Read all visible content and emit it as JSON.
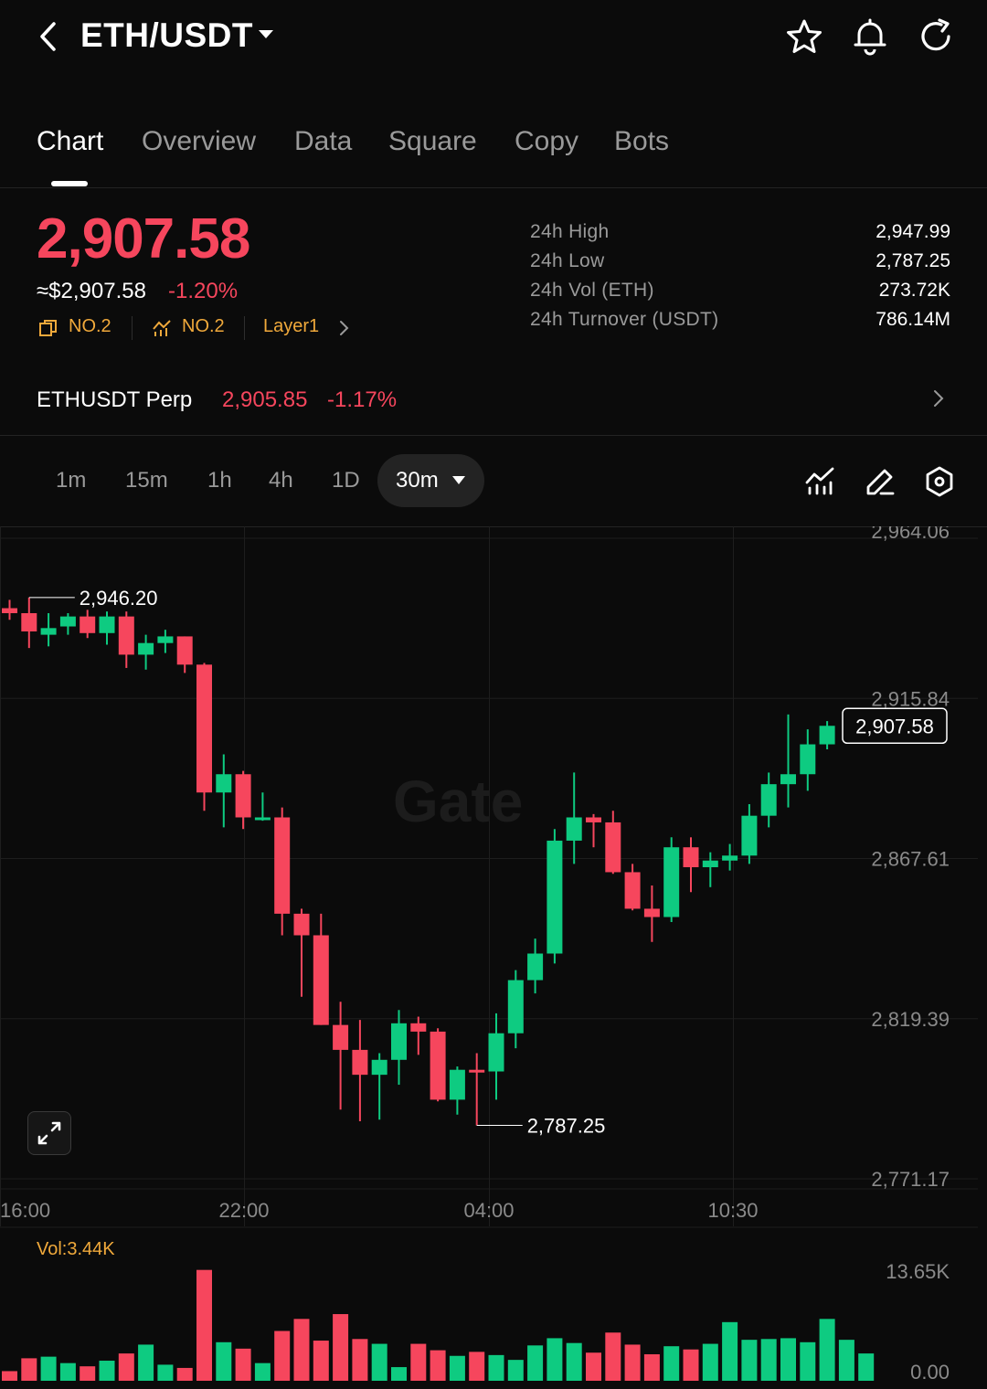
{
  "header": {
    "pair": "ETH/USDT",
    "icons": [
      "back-icon",
      "caret-down-icon",
      "star-icon",
      "bell-icon",
      "refresh-icon"
    ]
  },
  "tabs": [
    {
      "label": "Chart",
      "active": true
    },
    {
      "label": "Overview"
    },
    {
      "label": "Data"
    },
    {
      "label": "Square"
    },
    {
      "label": "Copy"
    },
    {
      "label": "Bots"
    }
  ],
  "ticker": {
    "last_price": "2,907.58",
    "usd_price": "≈$2,907.58",
    "change": "-1.20%",
    "tags": [
      {
        "icon": "rank-icon",
        "label": "NO.2"
      },
      {
        "icon": "trend-icon",
        "label": "NO.2"
      },
      {
        "label": "Layer1"
      }
    ],
    "stats": [
      {
        "label": "24h  High",
        "value": "2,947.99"
      },
      {
        "label": "24h  Low",
        "value": "2,787.25"
      },
      {
        "label": "24h  Vol (ETH)",
        "value": "273.72K"
      },
      {
        "label": "24h  Turnover (USDT)",
        "value": "786.14M"
      }
    ]
  },
  "perp": {
    "name": "ETHUSDT Perp",
    "price": "2,905.85",
    "change": "-1.17%"
  },
  "intervals": {
    "options": [
      "1m",
      "15m",
      "1h",
      "4h",
      "1D"
    ],
    "selected": "30m",
    "tool_icons": [
      "indicator-icon",
      "draw-pen-icon",
      "settings-hexagon-icon"
    ]
  },
  "colors": {
    "up": "#0ecb81",
    "down": "#f6465d",
    "accent": "#f0a93b"
  },
  "chart_data": {
    "type": "candlestick",
    "watermark": "Gate",
    "y_axis_labels": [
      "2,964.06",
      "2,915.84",
      "2,867.61",
      "2,819.39",
      "2,771.17"
    ],
    "ylim": [
      2771.17,
      2964.06
    ],
    "x_axis_labels": [
      "16:00",
      "22:00",
      "04:00",
      "10:30"
    ],
    "high_marker": "2,946.20",
    "low_marker": "2,787.25",
    "last_price_label": "2,907.58",
    "candles": [
      {
        "o": 2943.0,
        "h": 2945.5,
        "l": 2939.5,
        "c": 2941.5
      },
      {
        "o": 2941.5,
        "h": 2946.2,
        "l": 2931.0,
        "c": 2936.0
      },
      {
        "o": 2935.0,
        "h": 2941.5,
        "l": 2931.5,
        "c": 2937.0
      },
      {
        "o": 2937.5,
        "h": 2941.5,
        "l": 2935.0,
        "c": 2940.5
      },
      {
        "o": 2940.5,
        "h": 2942.5,
        "l": 2934.0,
        "c": 2935.5
      },
      {
        "o": 2935.5,
        "h": 2942.0,
        "l": 2932.0,
        "c": 2940.5
      },
      {
        "o": 2940.5,
        "h": 2942.0,
        "l": 2925.0,
        "c": 2929.0
      },
      {
        "o": 2929.0,
        "h": 2935.0,
        "l": 2924.5,
        "c": 2932.5
      },
      {
        "o": 2932.5,
        "h": 2936.5,
        "l": 2929.5,
        "c": 2934.5
      },
      {
        "o": 2934.5,
        "h": 2934.5,
        "l": 2923.5,
        "c": 2926.0
      },
      {
        "o": 2926.0,
        "h": 2926.5,
        "l": 2882.0,
        "c": 2887.5
      },
      {
        "o": 2887.5,
        "h": 2899.0,
        "l": 2877.0,
        "c": 2893.0
      },
      {
        "o": 2893.0,
        "h": 2894.0,
        "l": 2876.5,
        "c": 2880.0
      },
      {
        "o": 2880.0,
        "h": 2887.5,
        "l": 2879.0,
        "c": 2880.0
      },
      {
        "o": 2880.0,
        "h": 2883.0,
        "l": 2844.5,
        "c": 2851.0
      },
      {
        "o": 2851.0,
        "h": 2852.5,
        "l": 2826.0,
        "c": 2844.5
      },
      {
        "o": 2844.5,
        "h": 2851.0,
        "l": 2817.5,
        "c": 2817.5
      },
      {
        "o": 2817.5,
        "h": 2824.5,
        "l": 2792.0,
        "c": 2810.0
      },
      {
        "o": 2810.0,
        "h": 2819.0,
        "l": 2788.5,
        "c": 2802.5
      },
      {
        "o": 2802.5,
        "h": 2809.0,
        "l": 2789.0,
        "c": 2807.0
      },
      {
        "o": 2807.0,
        "h": 2822.0,
        "l": 2799.5,
        "c": 2818.0
      },
      {
        "o": 2818.0,
        "h": 2820.0,
        "l": 2808.5,
        "c": 2815.5
      },
      {
        "o": 2815.5,
        "h": 2816.5,
        "l": 2794.5,
        "c": 2795.0
      },
      {
        "o": 2795.0,
        "h": 2805.0,
        "l": 2790.5,
        "c": 2804.0
      },
      {
        "o": 2804.0,
        "h": 2809.0,
        "l": 2787.25,
        "c": 2803.5
      },
      {
        "o": 2803.5,
        "h": 2821.0,
        "l": 2795.0,
        "c": 2815.0
      },
      {
        "o": 2815.0,
        "h": 2834.0,
        "l": 2810.5,
        "c": 2831.0
      },
      {
        "o": 2831.0,
        "h": 2843.5,
        "l": 2827.0,
        "c": 2839.0
      },
      {
        "o": 2839.0,
        "h": 2876.5,
        "l": 2836.0,
        "c": 2873.0
      },
      {
        "o": 2873.0,
        "h": 2893.5,
        "l": 2866.0,
        "c": 2880.0
      },
      {
        "o": 2880.0,
        "h": 2881.0,
        "l": 2871.0,
        "c": 2878.5
      },
      {
        "o": 2878.5,
        "h": 2882.0,
        "l": 2863.0,
        "c": 2863.5
      },
      {
        "o": 2863.5,
        "h": 2866.0,
        "l": 2852.0,
        "c": 2852.5
      },
      {
        "o": 2852.5,
        "h": 2859.5,
        "l": 2842.5,
        "c": 2850.0
      },
      {
        "o": 2850.0,
        "h": 2874.0,
        "l": 2848.5,
        "c": 2871.0
      },
      {
        "o": 2871.0,
        "h": 2874.0,
        "l": 2857.5,
        "c": 2865.0
      },
      {
        "o": 2865.0,
        "h": 2869.5,
        "l": 2859.0,
        "c": 2867.0
      },
      {
        "o": 2867.0,
        "h": 2872.0,
        "l": 2864.0,
        "c": 2868.5
      },
      {
        "o": 2868.5,
        "h": 2884.0,
        "l": 2866.0,
        "c": 2880.5
      },
      {
        "o": 2880.5,
        "h": 2893.5,
        "l": 2877.0,
        "c": 2890.0
      },
      {
        "o": 2890.0,
        "h": 2911.0,
        "l": 2883.0,
        "c": 2893.0
      },
      {
        "o": 2893.0,
        "h": 2906.5,
        "l": 2888.0,
        "c": 2902.0
      },
      {
        "o": 2902.0,
        "h": 2909.0,
        "l": 2900.5,
        "c": 2907.58
      }
    ],
    "volume": {
      "label": "Vol:3.44K",
      "axis_labels": [
        "13.65K",
        "0.00"
      ],
      "ylim": [
        0,
        13.65
      ],
      "values": [
        1.2,
        2.8,
        3.0,
        2.2,
        1.8,
        2.5,
        3.4,
        4.5,
        2.0,
        1.6,
        13.8,
        4.8,
        4.0,
        2.2,
        6.2,
        7.7,
        5.0,
        8.3,
        5.2,
        4.6,
        1.7,
        4.6,
        3.8,
        3.1,
        3.6,
        3.2,
        2.6,
        4.4,
        5.3,
        4.7,
        3.5,
        6.0,
        4.5,
        3.3,
        4.3,
        3.9,
        4.6,
        7.3,
        5.1,
        5.2,
        5.3,
        4.8,
        7.7,
        5.1,
        3.4
      ]
    }
  }
}
